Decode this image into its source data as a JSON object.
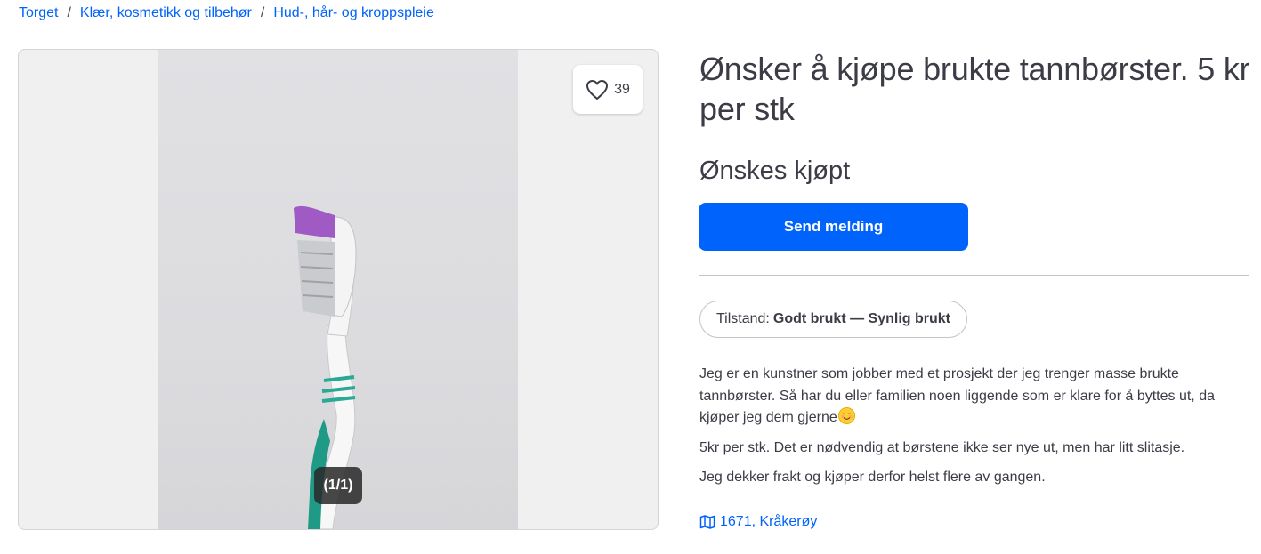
{
  "breadcrumb": [
    {
      "label": "Torget"
    },
    {
      "label": "Klær, kosmetikk og tilbehør"
    },
    {
      "label": "Hud-, hår- og kroppspleie"
    }
  ],
  "gallery": {
    "favorite_count": "39",
    "image_counter": "(1/1)"
  },
  "listing": {
    "title": "Ønsker å kjøpe brukte tannbørster. 5 kr per stk",
    "price_label": "Ønskes kjøpt",
    "send_button": "Send melding",
    "condition_label": "Tilstand:",
    "condition_value": "Godt brukt — Synlig brukt",
    "description": [
      "Jeg er en kunstner som jobber med et prosjekt der jeg trenger masse brukte tannbørster. Så har du eller familien noen liggende som er klare for å byttes ut, da kjøper jeg dem gjerne",
      "5kr per stk. Det er nødvendig at børstene ikke ser nye ut, men har litt slitasje.",
      "Jeg dekker frakt og kjøper derfor helst flere av gangen."
    ],
    "location": "1671, Kråkerøy"
  },
  "colors": {
    "accent": "#0063fb",
    "text": "#3c3c46"
  }
}
